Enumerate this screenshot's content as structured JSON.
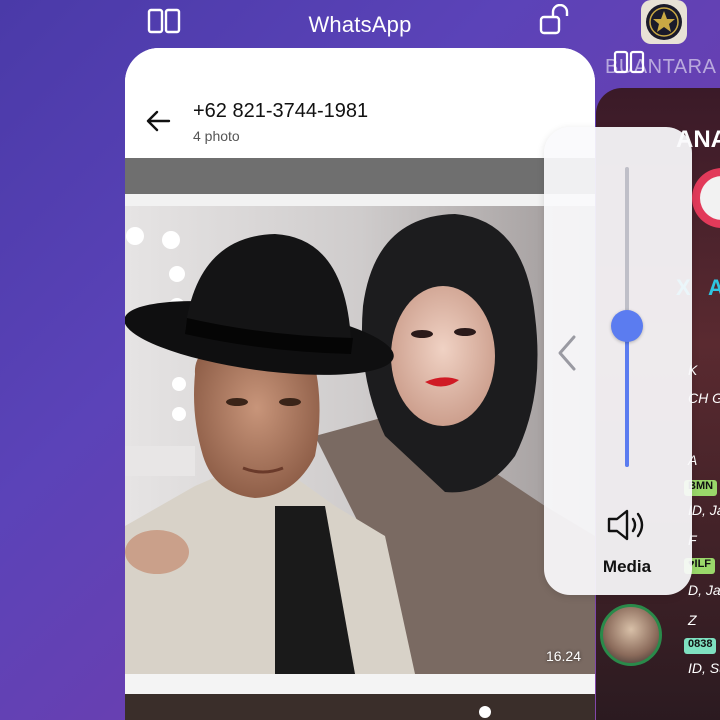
{
  "recents": {
    "app_title": "WhatsApp",
    "right_app_name": "BUANTARA",
    "icons": [
      "split-screen-icon",
      "lock-icon",
      "split-screen-icon"
    ]
  },
  "whatsapp": {
    "contact": "+62 821-3744-1981",
    "subtitle": "4 photo",
    "photo_time": "16.24"
  },
  "right_card": {
    "banner_text": "ANA",
    "sub_text": "X A",
    "lines": [
      {
        "text": "K",
        "badge": ""
      },
      {
        "text": "CH G",
        "badge": ""
      },
      {
        "text": "A",
        "badge": "BMN"
      },
      {
        "text": "ID, Jaw",
        "badge": ""
      },
      {
        "text": "F",
        "badge": "♥ILF"
      },
      {
        "text": "D, Jaw",
        "badge": ""
      },
      {
        "text": "Z",
        "badge": "0838"
      },
      {
        "text": "ID, Sun",
        "badge": ""
      }
    ]
  },
  "volume": {
    "label": "Media",
    "level": 0.47,
    "icon": "speaker-icon"
  },
  "colors": {
    "accent": "#5b7cf0",
    "background": "#4a3aa8"
  }
}
